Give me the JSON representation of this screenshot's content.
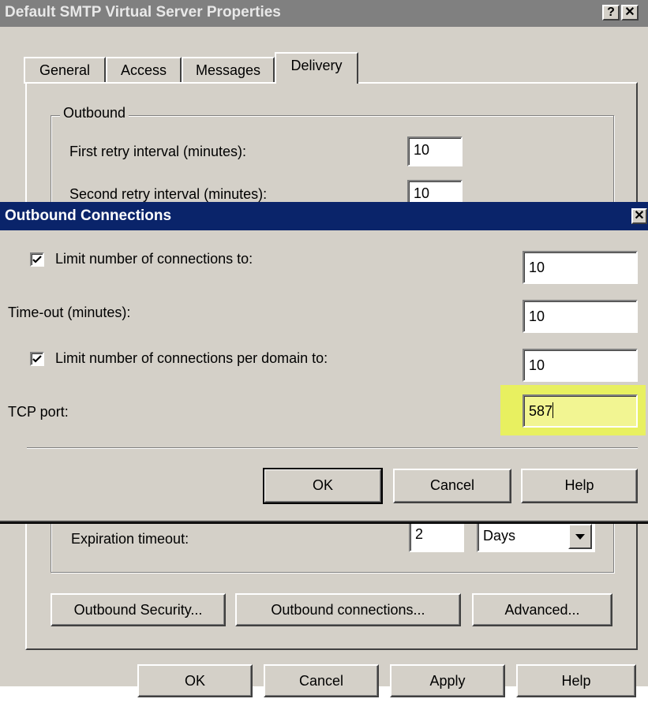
{
  "back_dialog": {
    "title": "Default SMTP Virtual Server Properties",
    "tabs": [
      "General",
      "Access",
      "Messages",
      "Delivery"
    ],
    "active_tab": "Delivery",
    "outbound_group_label": "Outbound",
    "first_retry_label": "First retry interval (minutes):",
    "first_retry_value": "10",
    "second_retry_label": "Second retry interval (minutes):",
    "second_retry_value": "10",
    "expiration_label": "Expiration timeout:",
    "expiration_value": "2",
    "expiration_unit": "Days",
    "outbound_security_button": "Outbound Security...",
    "outbound_connections_button": "Outbound connections...",
    "advanced_button": "Advanced...",
    "ok_button": "OK",
    "cancel_button": "Cancel",
    "apply_button": "Apply",
    "help_button": "Help",
    "help_title_glyph": "?",
    "close_glyph": "✕"
  },
  "front_dialog": {
    "title": "Outbound Connections",
    "limit_connections_label": "Limit number of connections to:",
    "limit_connections_checked": true,
    "limit_connections_value": "10",
    "timeout_label": "Time-out (minutes):",
    "timeout_value": "10",
    "limit_per_domain_label": "Limit number of connections per domain to:",
    "limit_per_domain_checked": true,
    "limit_per_domain_value": "10",
    "tcp_port_label": "TCP port:",
    "tcp_port_value": "587",
    "ok_button": "OK",
    "cancel_button": "Cancel",
    "help_button": "Help",
    "close_glyph": "✕"
  },
  "colors": {
    "dialog_face": "#d4d0c8",
    "active_title": "#0a246a",
    "inactive_title": "#808080",
    "highlight": "#e8f060"
  }
}
